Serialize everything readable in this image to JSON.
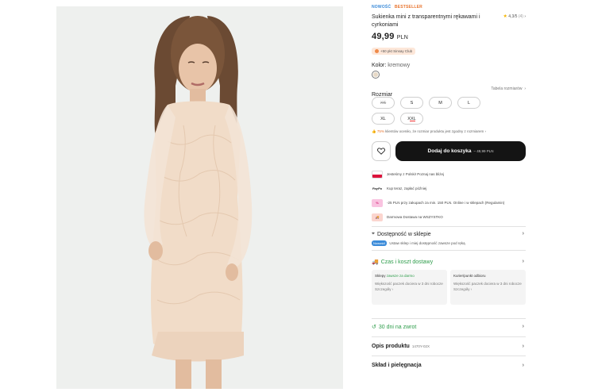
{
  "product": {
    "badge_new": "NOWOŚĆ",
    "badge_bestseller": "BESTSELLER",
    "title": "Sukienka mini z transparentnymi rękawami i cyrkoniami",
    "rating_value": "4,3/5",
    "rating_count": "(4)",
    "price_main": "49,99",
    "price_currency": "PLN",
    "club_text": "+50 pkt Sinsay Club"
  },
  "color": {
    "label": "Kolor:",
    "value": "kremowy",
    "swatch_hex": "#e7d9c6"
  },
  "size": {
    "label": "Rozmiar",
    "table_link": "Tabela rozmiarów",
    "options": [
      {
        "label": "XS",
        "state": "sold_out"
      },
      {
        "label": "S",
        "state": "available"
      },
      {
        "label": "M",
        "state": "available"
      },
      {
        "label": "L",
        "state": "available"
      },
      {
        "label": "XL",
        "state": "available"
      },
      {
        "label": "XXL",
        "state": "low_stock"
      }
    ],
    "fit_pct": "75%",
    "fit_text": "klientów oceniło, że rozmiar produktu jest zgodny z rozmiarem"
  },
  "cart": {
    "button_label": "Dodaj do koszyka",
    "button_price": "– 49,99 PLN"
  },
  "perks": [
    {
      "icon": "poland-flag-icon",
      "text": "Jesteśmy z Polski! Poznaj nas bliżej"
    },
    {
      "icon": "paypo-icon",
      "icon_text": "PayPo",
      "text": "Kup teraz, zapłać później"
    },
    {
      "icon": "discount-tag-icon",
      "text": "-25 PLN przy zakupach za min. 150 PLN. Online i w sklepach (Regulamin)"
    },
    {
      "icon": "delivery-truck-icon",
      "text": "Darmowa Dostawa na WSZYSTKO"
    }
  ],
  "availability": {
    "title": "Dostępność w sklepie",
    "new_badge": "Nowość!",
    "text": "Ustaw sklep i miej dostępność zawsze pod ręką"
  },
  "delivery": {
    "title": "Czas i koszt dostawy",
    "stores_label": "Sklepy",
    "stores_free": "zawsze za darmo",
    "stores_time": "Większość paczek dociera w 3 dni robocze",
    "stores_more": "Szczegóły ›",
    "courier_label": "Kurier/punkt odbioru",
    "courier_time": "Większość paczek dociera w 3 dni robocze",
    "courier_more": "Szczegóły ›"
  },
  "returns": {
    "title": "30 dni na zwrot"
  },
  "description": {
    "title": "Opis produktu",
    "code": "1470Y-02X"
  },
  "composition": {
    "title": "Skład i pielęgnacja"
  },
  "colors": {
    "accent_orange": "#e8742e",
    "accent_blue": "#3b8bd9",
    "green": "#2e9d4b",
    "cart_bg": "#141414"
  }
}
